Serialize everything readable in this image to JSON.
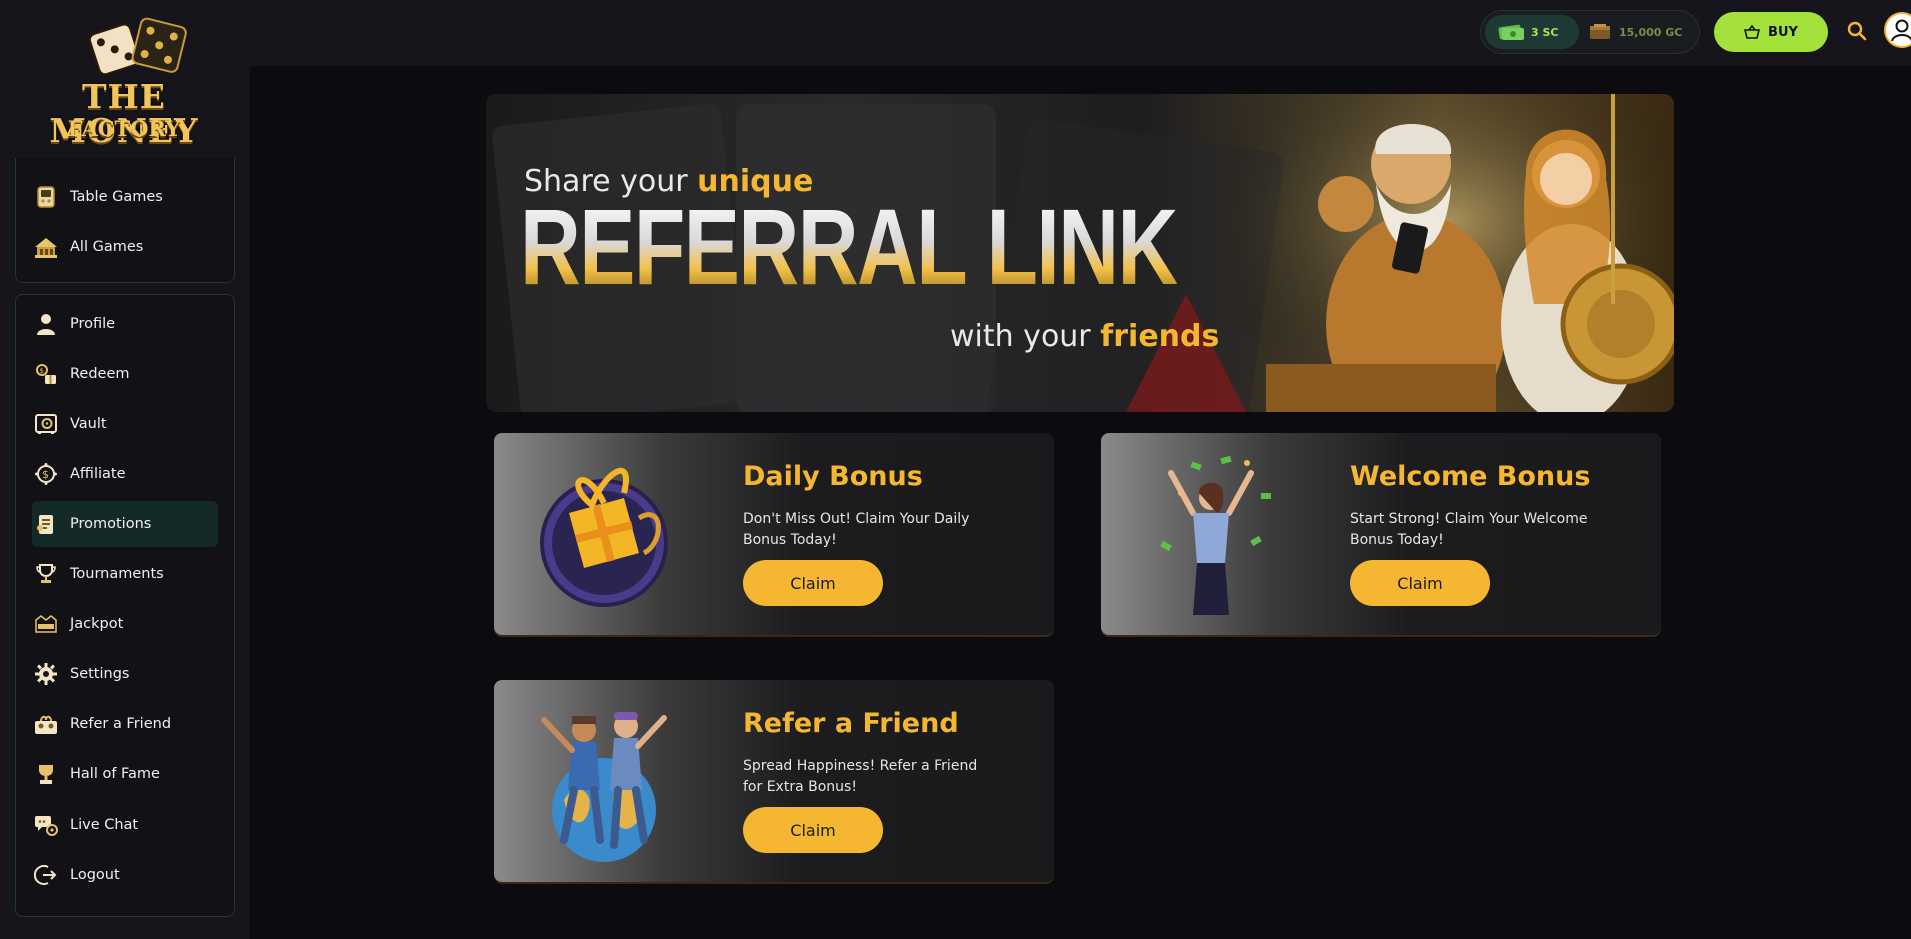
{
  "brand": {
    "line1": "THE MONEY",
    "line2": "FACTORY"
  },
  "sidebar": {
    "group1": [
      {
        "label": "Table Games",
        "icon": "table-games-icon"
      },
      {
        "label": "All Games",
        "icon": "all-games-icon"
      }
    ],
    "group2": [
      {
        "label": "Profile",
        "icon": "profile-icon"
      },
      {
        "label": "Redeem",
        "icon": "redeem-icon"
      },
      {
        "label": "Vault",
        "icon": "vault-icon"
      },
      {
        "label": "Affiliate",
        "icon": "affiliate-icon"
      },
      {
        "label": "Promotions",
        "icon": "promotions-icon",
        "active": true
      },
      {
        "label": "Tournaments",
        "icon": "tournaments-icon"
      },
      {
        "label": "Jackpot",
        "icon": "jackpot-icon"
      },
      {
        "label": "Settings",
        "icon": "settings-icon"
      },
      {
        "label": "Refer a Friend",
        "icon": "refer-icon"
      },
      {
        "label": "Hall of Fame",
        "icon": "hall-of-fame-icon"
      },
      {
        "label": "Live Chat",
        "icon": "live-chat-icon"
      },
      {
        "label": "Logout",
        "icon": "logout-icon"
      }
    ]
  },
  "topbar": {
    "sc_balance": "3 SC",
    "gc_balance": "15,000 GC",
    "buy_label": "BUY"
  },
  "banner": {
    "line1_prefix": "Share your ",
    "line1_highlight": "unique",
    "big": "REFERRAL LINK",
    "line3_prefix": "with your ",
    "line3_highlight": "friends"
  },
  "promos": [
    {
      "title": "Daily Bonus",
      "desc": "Don't Miss Out! Claim Your Daily Bonus Today!",
      "button": "Claim"
    },
    {
      "title": "Welcome Bonus",
      "desc": "Start Strong! Claim Your Welcome Bonus Today!",
      "button": "Claim"
    },
    {
      "title": "Refer a Friend",
      "desc": "Spread Happiness! Refer a Friend for Extra Bonus!",
      "button": "Claim"
    }
  ],
  "colors": {
    "accent": "#f5b731",
    "buy": "#a3e23a",
    "active_nav": "#142a27",
    "nav_border": "#1d3a35"
  }
}
